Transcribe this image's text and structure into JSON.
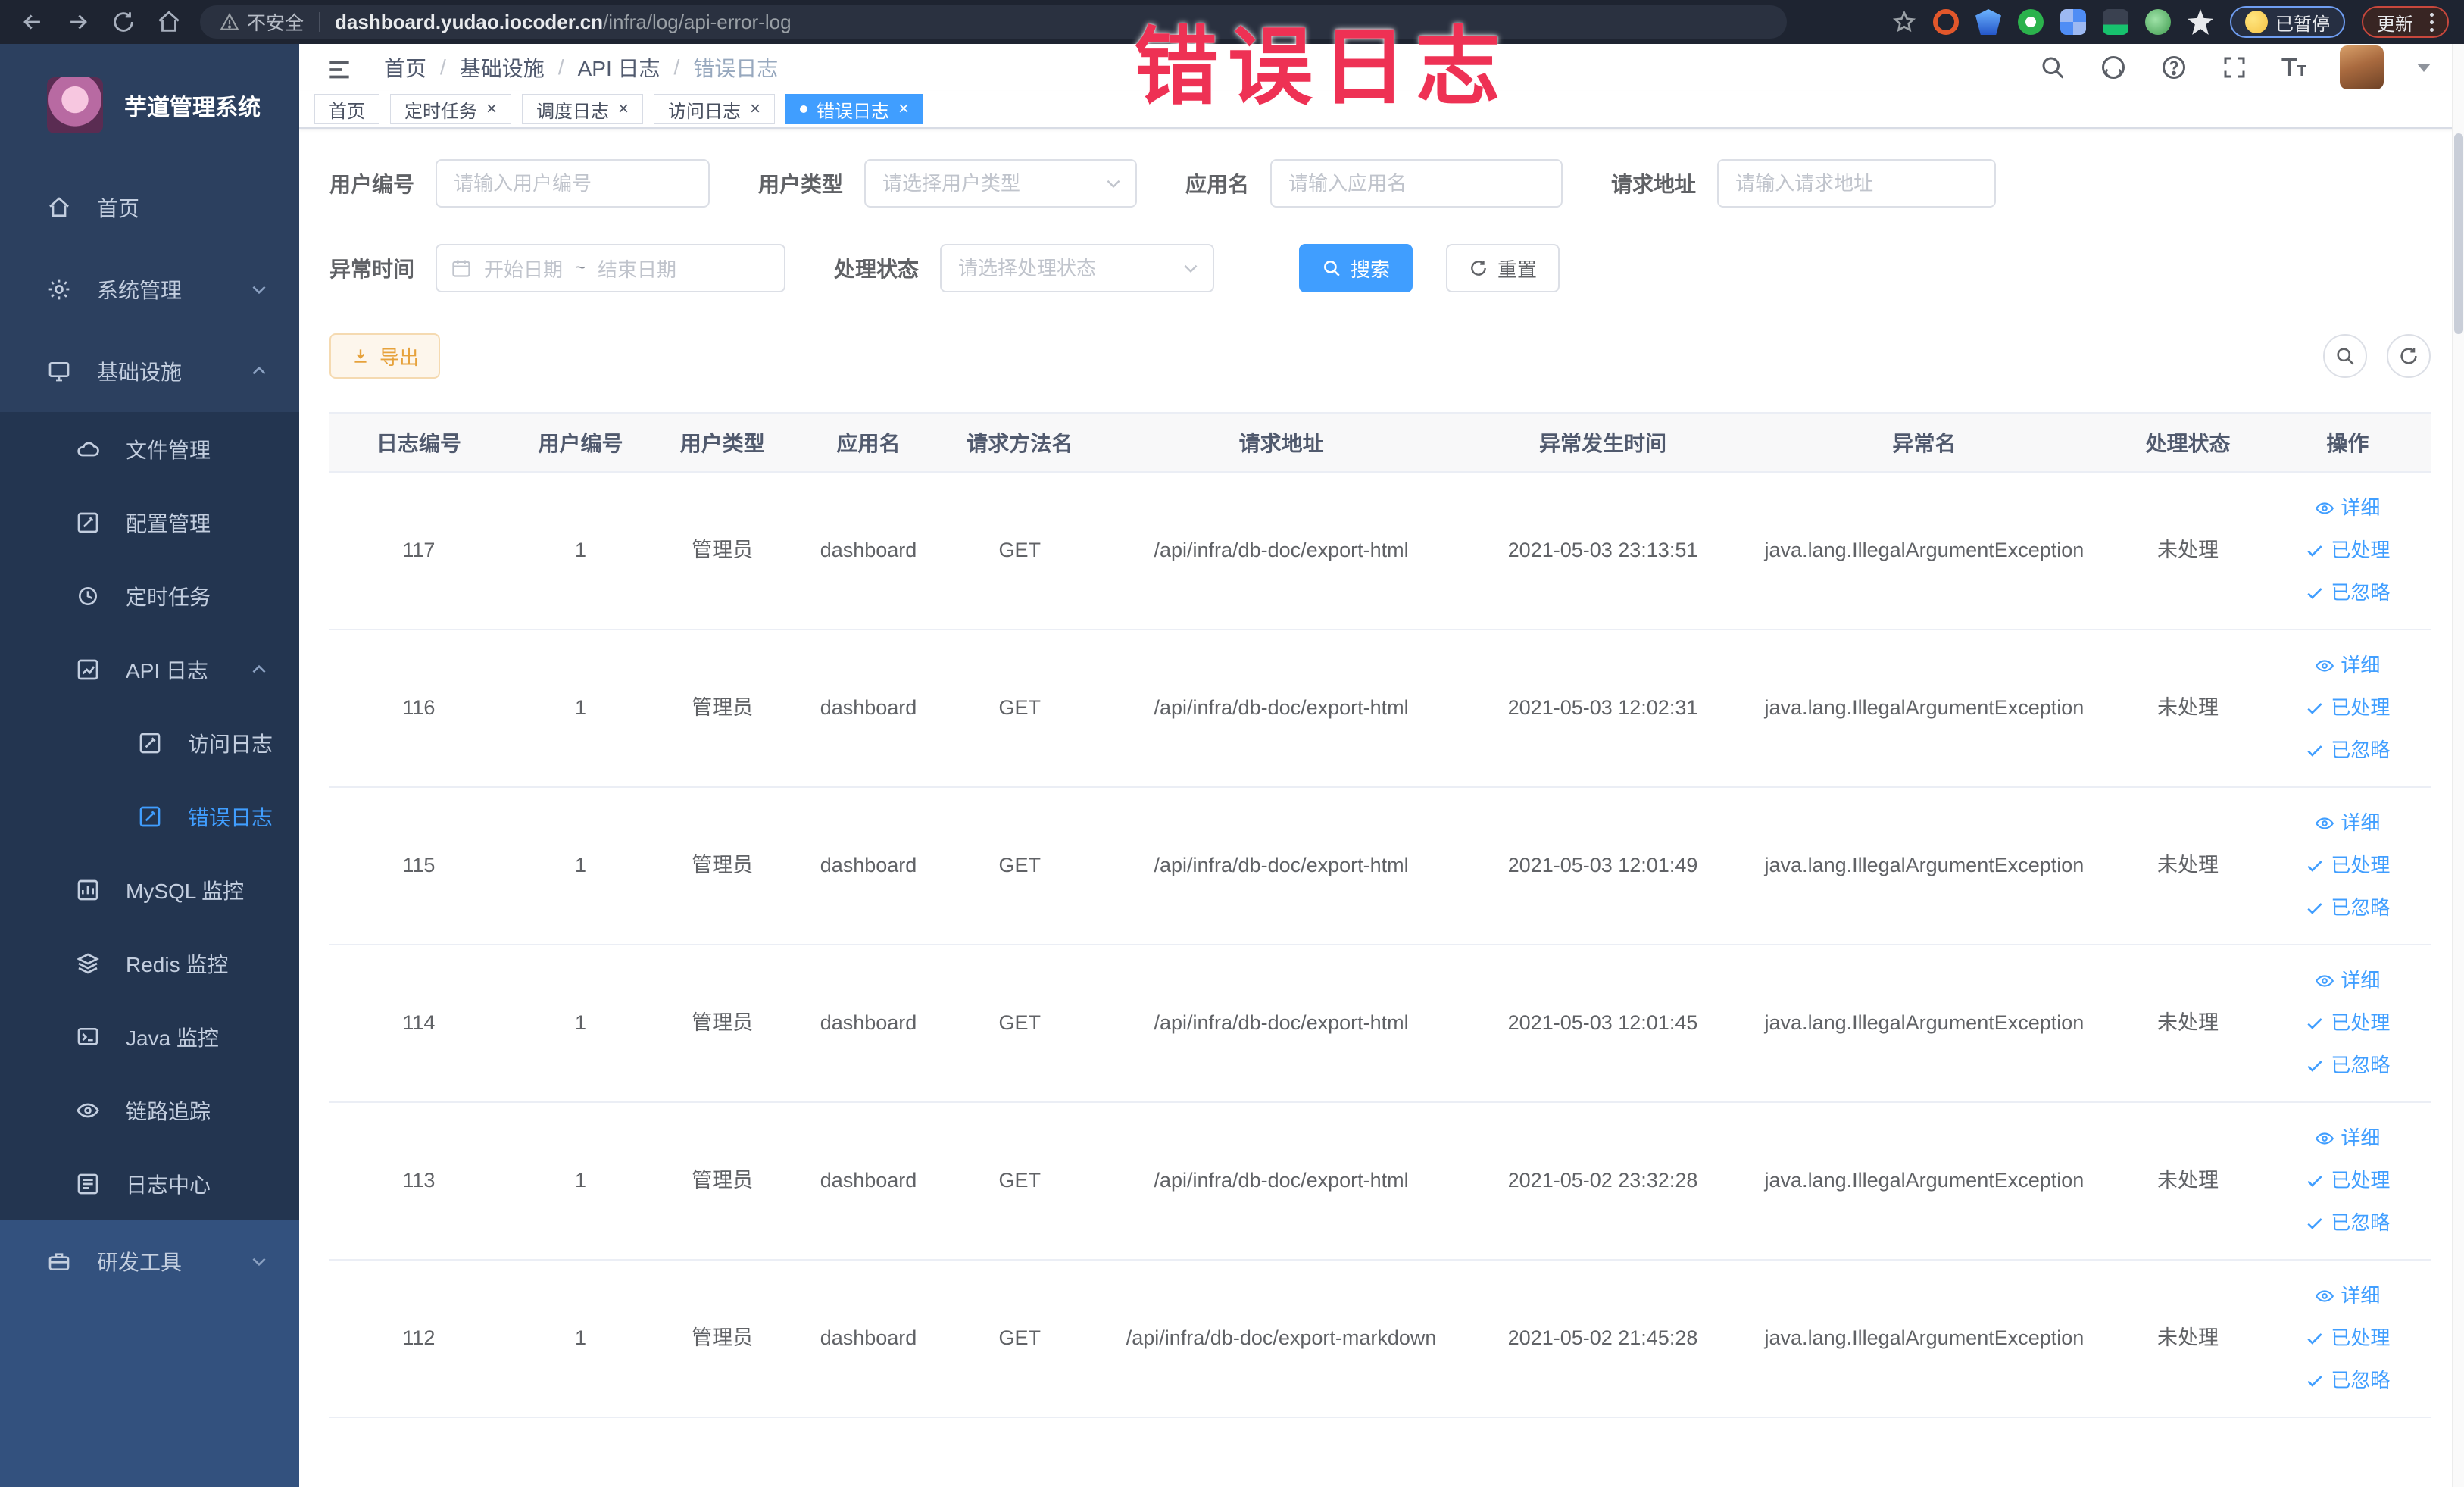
{
  "glyphs": {
    "slash": "/",
    "close": "×",
    "question": "?",
    "letter_T": "T"
  },
  "browser": {
    "security_label": "不安全",
    "url_domain": "dashboard.yudao.iocoder.cn",
    "url_path": "/infra/log/api-error-log",
    "paused_label": "已暂停",
    "update_label": "更新",
    "extension_colors": [
      "#e2572b",
      "#3d7ff2",
      "#2bb24c",
      "#4f8df5",
      "#17c26e",
      "#58b55c",
      "#e8eaed"
    ]
  },
  "overlay": {
    "text": "错误日志",
    "color": "#ee3154"
  },
  "sidebar": {
    "title": "芋道管理系统",
    "home": {
      "label": "首页"
    },
    "system": {
      "label": "系统管理"
    },
    "infra": {
      "label": "基础设施"
    },
    "infra_children": {
      "file": "文件管理",
      "config": "配置管理",
      "job": "定时任务",
      "apilog": "API 日志",
      "accesslog": "访问日志",
      "errorlog": "错误日志",
      "mysql": "MySQL 监控",
      "redis": "Redis 监控",
      "java": "Java 监控",
      "trace": "链路追踪",
      "logcenter": "日志中心"
    },
    "devtool": {
      "label": "研发工具"
    }
  },
  "breadcrumb": {
    "items": [
      "首页",
      "基础设施",
      "API 日志",
      "错误日志"
    ]
  },
  "tags": {
    "home": "首页",
    "job": "定时任务",
    "schedule_log": "调度日志",
    "access_log": "访问日志",
    "error_log": "错误日志"
  },
  "filters": {
    "user_id_label": "用户编号",
    "user_id_placeholder": "请输入用户编号",
    "user_type_label": "用户类型",
    "user_type_placeholder": "请选择用户类型",
    "app_name_label": "应用名",
    "app_name_placeholder": "请输入应用名",
    "request_url_label": "请求地址",
    "request_url_placeholder": "请输入请求地址",
    "exception_time_label": "异常时间",
    "start_date_placeholder": "开始日期",
    "range_separator": "~",
    "end_date_placeholder": "结束日期",
    "process_status_label": "处理状态",
    "process_status_placeholder": "请选择处理状态",
    "search_label": "搜索",
    "reset_label": "重置"
  },
  "toolbar": {
    "export_label": "导出"
  },
  "table": {
    "columns": [
      "日志编号",
      "用户编号",
      "用户类型",
      "应用名",
      "请求方法名",
      "请求地址",
      "异常发生时间",
      "异常名",
      "处理状态",
      "操作"
    ],
    "actions": {
      "detail": "详细",
      "processed": "已处理",
      "ignored": "已忽略"
    },
    "rows": [
      {
        "id": "117",
        "user_id": "1",
        "user_type": "管理员",
        "app": "dashboard",
        "method": "GET",
        "url": "/api/infra/db-doc/export-html",
        "time": "2021-05-03 23:13:51",
        "exception": "java.lang.IllegalArgumentException",
        "status": "未处理"
      },
      {
        "id": "116",
        "user_id": "1",
        "user_type": "管理员",
        "app": "dashboard",
        "method": "GET",
        "url": "/api/infra/db-doc/export-html",
        "time": "2021-05-03 12:02:31",
        "exception": "java.lang.IllegalArgumentException",
        "status": "未处理"
      },
      {
        "id": "115",
        "user_id": "1",
        "user_type": "管理员",
        "app": "dashboard",
        "method": "GET",
        "url": "/api/infra/db-doc/export-html",
        "time": "2021-05-03 12:01:49",
        "exception": "java.lang.IllegalArgumentException",
        "status": "未处理"
      },
      {
        "id": "114",
        "user_id": "1",
        "user_type": "管理员",
        "app": "dashboard",
        "method": "GET",
        "url": "/api/infra/db-doc/export-html",
        "time": "2021-05-03 12:01:45",
        "exception": "java.lang.IllegalArgumentException",
        "status": "未处理"
      },
      {
        "id": "113",
        "user_id": "1",
        "user_type": "管理员",
        "app": "dashboard",
        "method": "GET",
        "url": "/api/infra/db-doc/export-html",
        "time": "2021-05-02 23:32:28",
        "exception": "java.lang.IllegalArgumentException",
        "status": "未处理"
      },
      {
        "id": "112",
        "user_id": "1",
        "user_type": "管理员",
        "app": "dashboard",
        "method": "GET",
        "url": "/api/infra/db-doc/export-markdown",
        "time": "2021-05-02 21:45:28",
        "exception": "java.lang.IllegalArgumentException",
        "status": "未处理"
      }
    ]
  }
}
